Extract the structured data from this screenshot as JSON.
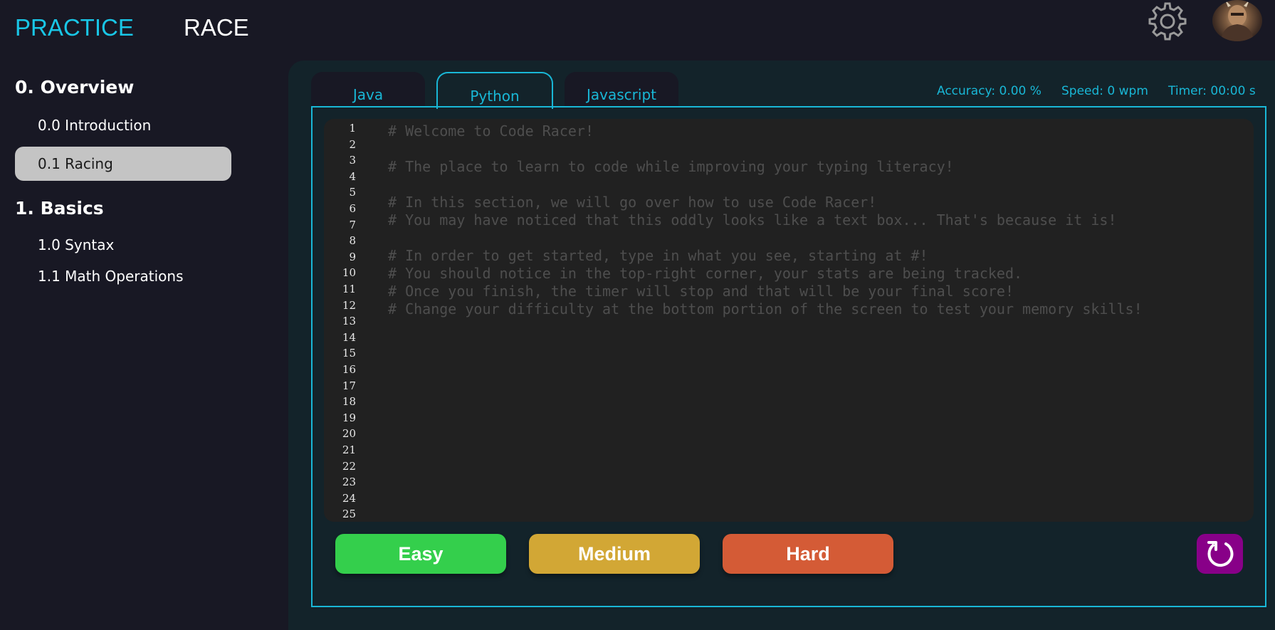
{
  "nav": {
    "practice": "PRACTICE",
    "race": "RACE"
  },
  "icons": {
    "settings": "gear-icon",
    "avatar": "avatar",
    "reset": "reset-icon"
  },
  "colors": {
    "accent": "#19b7d6",
    "easy": "#34cf4c",
    "medium": "#d2a735",
    "hard": "#d45b36",
    "reset": "#880088",
    "active_item": "#c4c4c4"
  },
  "sidebar": {
    "sections": [
      {
        "title": "0. Overview",
        "items": [
          {
            "label": "0.0 Introduction",
            "active": false
          },
          {
            "label": "0.1 Racing",
            "active": true
          }
        ]
      },
      {
        "title": "1. Basics",
        "items": [
          {
            "label": "1.0 Syntax",
            "active": false
          },
          {
            "label": "1.1 Math Operations",
            "active": false
          }
        ]
      }
    ]
  },
  "tabs": [
    {
      "label": "Java"
    },
    {
      "label": "Python",
      "active": true
    },
    {
      "label": "Javascript"
    }
  ],
  "stats": {
    "accuracy": "Accuracy: 0.00 %",
    "speed": "Speed: 0 wpm",
    "timer": "Timer: 00:00 s"
  },
  "editor": {
    "line_numbers": [
      "1",
      "2",
      "3",
      "4",
      "5",
      "6",
      "7",
      "8",
      "9",
      "10",
      "11",
      "12",
      "13",
      "14",
      "15",
      "16",
      "17",
      "18",
      "19",
      "20",
      "21",
      "22",
      "23",
      "24",
      "25"
    ],
    "lines": [
      "# Welcome to Code Racer!",
      "",
      "# The place to learn to code while improving your typing literacy!",
      "",
      "# In this section, we will go over how to use Code Racer!",
      "# You may have noticed that this oddly looks like a text box... That's because it is!",
      "",
      "# In order to get started, type in what you see, starting at #!",
      "# You should notice in the top-right corner, your stats are being tracked.",
      "# Once you finish, the timer will stop and that will be your final score!",
      "# Change your difficulty at the bottom portion of the screen to test your memory skills!"
    ]
  },
  "difficulty": {
    "easy": "Easy",
    "medium": "Medium",
    "hard": "Hard"
  }
}
